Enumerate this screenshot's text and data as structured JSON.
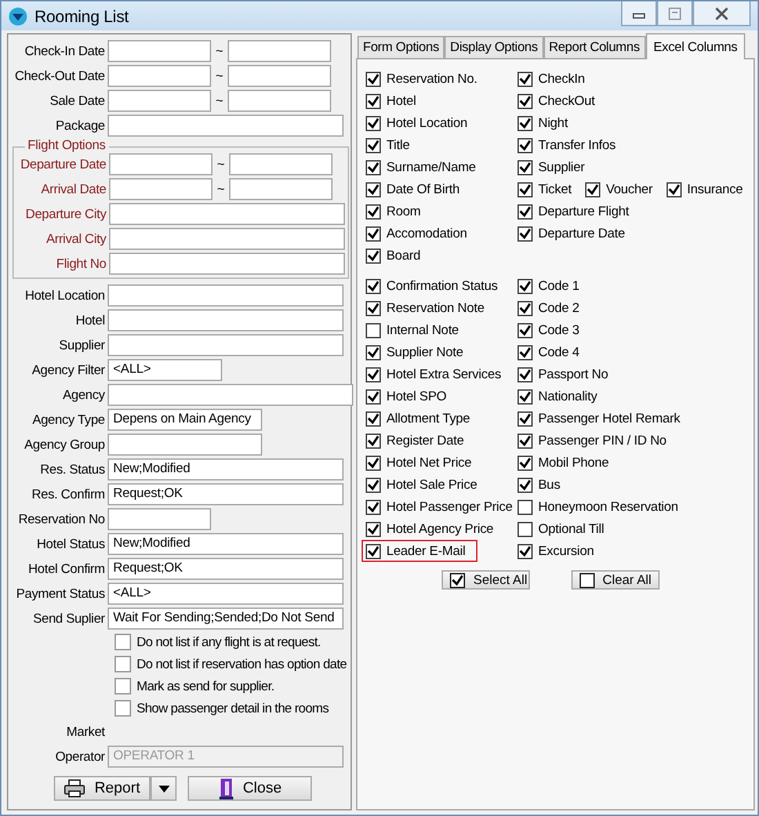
{
  "window": {
    "title": "Rooming List"
  },
  "form": {
    "rows": [
      {
        "kind": "range",
        "label": "Check-In Date",
        "separator": "~"
      },
      {
        "kind": "range",
        "label": "Check-Out Date",
        "separator": "~"
      },
      {
        "kind": "range",
        "label": "Sale Date",
        "separator": "~"
      },
      {
        "kind": "long",
        "label": "Package"
      }
    ],
    "flight_options": {
      "title": "Flight Options",
      "rows": [
        {
          "kind": "range",
          "label": "Departure Date",
          "separator": "~"
        },
        {
          "kind": "range",
          "label": "Arrival Date",
          "separator": "~"
        },
        {
          "kind": "long",
          "label": "Departure City"
        },
        {
          "kind": "long",
          "label": "Arrival City"
        },
        {
          "kind": "long",
          "label": "Flight No"
        }
      ]
    },
    "rows2": [
      {
        "kind": "long",
        "label": "Hotel Location"
      },
      {
        "kind": "long",
        "label": "Hotel"
      },
      {
        "kind": "long",
        "label": "Supplier"
      },
      {
        "kind": "short",
        "label": "Agency Filter",
        "value": "<ALL>"
      },
      {
        "kind": "full",
        "label": "Agency"
      },
      {
        "kind": "medium",
        "label": "Agency Type",
        "value": "Depens on Main Agency"
      },
      {
        "kind": "medium",
        "label": "Agency Group"
      },
      {
        "kind": "long",
        "label": "Res. Status",
        "value": "New;Modified"
      },
      {
        "kind": "long",
        "label": "Res. Confirm",
        "value": "Request;OK"
      },
      {
        "kind": "range1",
        "label": "Reservation No"
      },
      {
        "kind": "long",
        "label": "Hotel Status",
        "value": "New;Modified"
      },
      {
        "kind": "long",
        "label": "Hotel Confirm",
        "value": "Request;OK"
      },
      {
        "kind": "long",
        "label": "Payment Status",
        "value": "<ALL>"
      },
      {
        "kind": "long",
        "label": "Send Suplier",
        "value": "Wait For Sending;Sended;Do Not Send"
      }
    ],
    "checkboxes": [
      {
        "label": "Do not list if any flight is at request.",
        "checked": false
      },
      {
        "label": "Do not list if reservation has option date",
        "checked": false
      },
      {
        "label": "Mark as send for supplier.",
        "checked": false
      },
      {
        "label": "Show passenger detail in the rooms",
        "checked": false
      }
    ],
    "rows3": [
      {
        "kind": "label",
        "label": "Market"
      },
      {
        "kind": "long",
        "label": "Operator",
        "value": "OPERATOR 1",
        "disabled": true
      }
    ],
    "buttons": [
      {
        "label": "Report",
        "kind": "report"
      },
      {
        "label": "Close",
        "kind": "close"
      }
    ]
  },
  "tabs": [
    {
      "label": "Form Options",
      "selected": false
    },
    {
      "label": "Display Options",
      "selected": false
    },
    {
      "label": "Report Columns",
      "selected": false
    },
    {
      "label": "Excel Columns",
      "selected": true
    }
  ],
  "excel_columns": {
    "groups": [
      {
        "left": [
          {
            "label": "Reservation No.",
            "checked": true,
            "highlighted": false
          },
          {
            "label": "Hotel",
            "checked": true,
            "highlighted": false
          },
          {
            "label": "Hotel Location",
            "checked": true,
            "highlighted": false
          },
          {
            "label": "Title",
            "checked": true,
            "highlighted": false
          },
          {
            "label": "Surname/Name",
            "checked": true,
            "highlighted": false
          },
          {
            "label": "Date Of Birth",
            "checked": true,
            "highlighted": false
          },
          {
            "label": "Room",
            "checked": true,
            "highlighted": false
          },
          {
            "label": "Accomodation",
            "checked": true,
            "highlighted": false
          },
          {
            "label": "Board",
            "checked": true,
            "highlighted": false
          }
        ],
        "right": [
          [
            {
              "label": "CheckIn",
              "checked": true
            }
          ],
          [
            {
              "label": "CheckOut",
              "checked": true
            }
          ],
          [
            {
              "label": "Night",
              "checked": true
            }
          ],
          [
            {
              "label": "Transfer Infos",
              "checked": true
            }
          ],
          [
            {
              "label": "Supplier",
              "checked": true
            }
          ],
          [
            {
              "label": "Ticket",
              "checked": true
            },
            {
              "label": "Voucher",
              "checked": true
            },
            {
              "label": "Insurance",
              "checked": true
            }
          ],
          [
            {
              "label": "Departure Flight",
              "checked": true
            }
          ],
          [
            {
              "label": "Departure Date",
              "checked": true
            }
          ]
        ]
      },
      {
        "left": [
          {
            "label": "Confirmation Status",
            "checked": true,
            "highlighted": false
          },
          {
            "label": "Reservation Note",
            "checked": true,
            "highlighted": false
          },
          {
            "label": "Internal Note",
            "checked": false,
            "highlighted": false
          },
          {
            "label": "Supplier Note",
            "checked": true,
            "highlighted": false
          },
          {
            "label": "Hotel Extra Services",
            "checked": true,
            "highlighted": false
          },
          {
            "label": "Hotel SPO",
            "checked": true,
            "highlighted": false
          },
          {
            "label": "Allotment Type",
            "checked": true,
            "highlighted": false
          },
          {
            "label": "Register Date",
            "checked": true,
            "highlighted": false
          },
          {
            "label": "Hotel Net Price",
            "checked": true,
            "highlighted": false
          },
          {
            "label": "Hotel Sale Price",
            "checked": true,
            "highlighted": false
          },
          {
            "label": "Hotel Passenger Price",
            "checked": true,
            "highlighted": false
          },
          {
            "label": "Hotel Agency Price",
            "checked": true,
            "highlighted": false
          },
          {
            "label": "Leader E-Mail",
            "checked": true,
            "highlighted": true
          }
        ],
        "right": [
          [
            {
              "label": "Code 1",
              "checked": true
            }
          ],
          [
            {
              "label": "Code 2",
              "checked": true
            }
          ],
          [
            {
              "label": "Code 3",
              "checked": true
            }
          ],
          [
            {
              "label": "Code 4",
              "checked": true
            }
          ],
          [
            {
              "label": "Passport No",
              "checked": true
            }
          ],
          [
            {
              "label": "Nationality",
              "checked": true
            }
          ],
          [
            {
              "label": "Passenger Hotel Remark",
              "checked": true
            }
          ],
          [
            {
              "label": "Passenger PIN / ID No",
              "checked": true
            }
          ],
          [
            {
              "label": "Mobil Phone",
              "checked": true
            }
          ],
          [
            {
              "label": "Bus",
              "checked": true
            }
          ],
          [
            {
              "label": "Honeymoon Reservation",
              "checked": false
            }
          ],
          [
            {
              "label": "Optional Till",
              "checked": false
            }
          ],
          [
            {
              "label": "Excursion",
              "checked": true
            }
          ]
        ]
      }
    ],
    "buttons": [
      {
        "label": "Select All",
        "checked": true
      },
      {
        "label": "Clear All",
        "checked": false
      }
    ]
  }
}
